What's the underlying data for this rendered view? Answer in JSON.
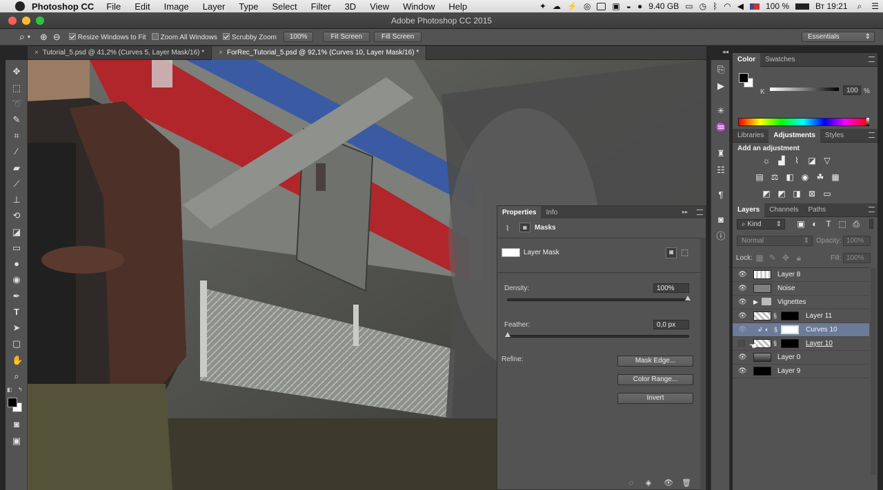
{
  "menubar": {
    "app_name": "Photoshop CC",
    "items": [
      "File",
      "Edit",
      "Image",
      "Layer",
      "Type",
      "Select",
      "Filter",
      "3D",
      "View",
      "Window",
      "Help"
    ],
    "disk_free": "9.40 GB",
    "battery": "100 %",
    "clock": "Вт 19:21"
  },
  "window": {
    "title": "Adobe Photoshop CC 2015"
  },
  "options": {
    "resize_windows": "Resize Windows to Fit",
    "zoom_all": "Zoom All Windows",
    "scrubby": "Scrubby Zoom",
    "zoom_100": "100%",
    "fit_screen": "Fit Screen",
    "fill_screen": "Fill Screen",
    "workspace": "Essentials"
  },
  "tabs": [
    {
      "label": "Tutorial_5.psd @ 41,2% (Curves 5, Layer Mask/16) *"
    },
    {
      "label": "ForRec_Tutorial_5.psd @ 92,1% (Curves 10, Layer Mask/16) *"
    }
  ],
  "color_panel": {
    "tabs": [
      "Color",
      "Swatches"
    ],
    "channel": "K",
    "value": "100",
    "unit": "%"
  },
  "adjustments_panel": {
    "tabs": [
      "Libraries",
      "Adjustments",
      "Styles"
    ],
    "heading": "Add an adjustment"
  },
  "layers_panel": {
    "tabs": [
      "Layers",
      "Channels",
      "Paths"
    ],
    "filter": "Kind",
    "blend_mode": "Normal",
    "opacity_label": "Opacity:",
    "opacity": "100%",
    "lock_label": "Lock:",
    "fill_label": "Fill:",
    "fill": "100%",
    "layers": [
      {
        "name": "Layer 8"
      },
      {
        "name": "Noise"
      },
      {
        "name": "Vignettes"
      },
      {
        "name": "Layer 11"
      },
      {
        "name": "Curves 10"
      },
      {
        "name": "Layer 10"
      },
      {
        "name": "Layer 0"
      },
      {
        "name": "Layer 9"
      }
    ]
  },
  "properties_panel": {
    "tabs": [
      "Properties",
      "Info"
    ],
    "section": "Masks",
    "mask_type": "Layer Mask",
    "density_label": "Density:",
    "density": "100%",
    "feather_label": "Feather:",
    "feather": "0,0 px",
    "refine_label": "Refine:",
    "mask_edge": "Mask Edge...",
    "color_range": "Color Range...",
    "invert": "Invert"
  }
}
